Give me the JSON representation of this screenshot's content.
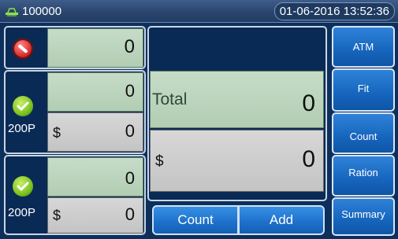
{
  "header": {
    "serial": "100000",
    "datetime": "01-06-2016 13:52:36"
  },
  "rows": [
    {
      "status": "stop",
      "count": "0"
    },
    {
      "status": "ok",
      "denomination": "200P",
      "count": "0",
      "currency": "$",
      "amount": "0"
    },
    {
      "status": "ok",
      "denomination": "200P",
      "count": "0",
      "currency": "$",
      "amount": "0"
    }
  ],
  "total": {
    "label": "Total",
    "count": "0",
    "currency": "$",
    "amount": "0"
  },
  "bottom_buttons": [
    "Count",
    "Add"
  ],
  "side_buttons": [
    "ATM",
    "Fit",
    "Count",
    "Ration",
    "Summary"
  ]
}
